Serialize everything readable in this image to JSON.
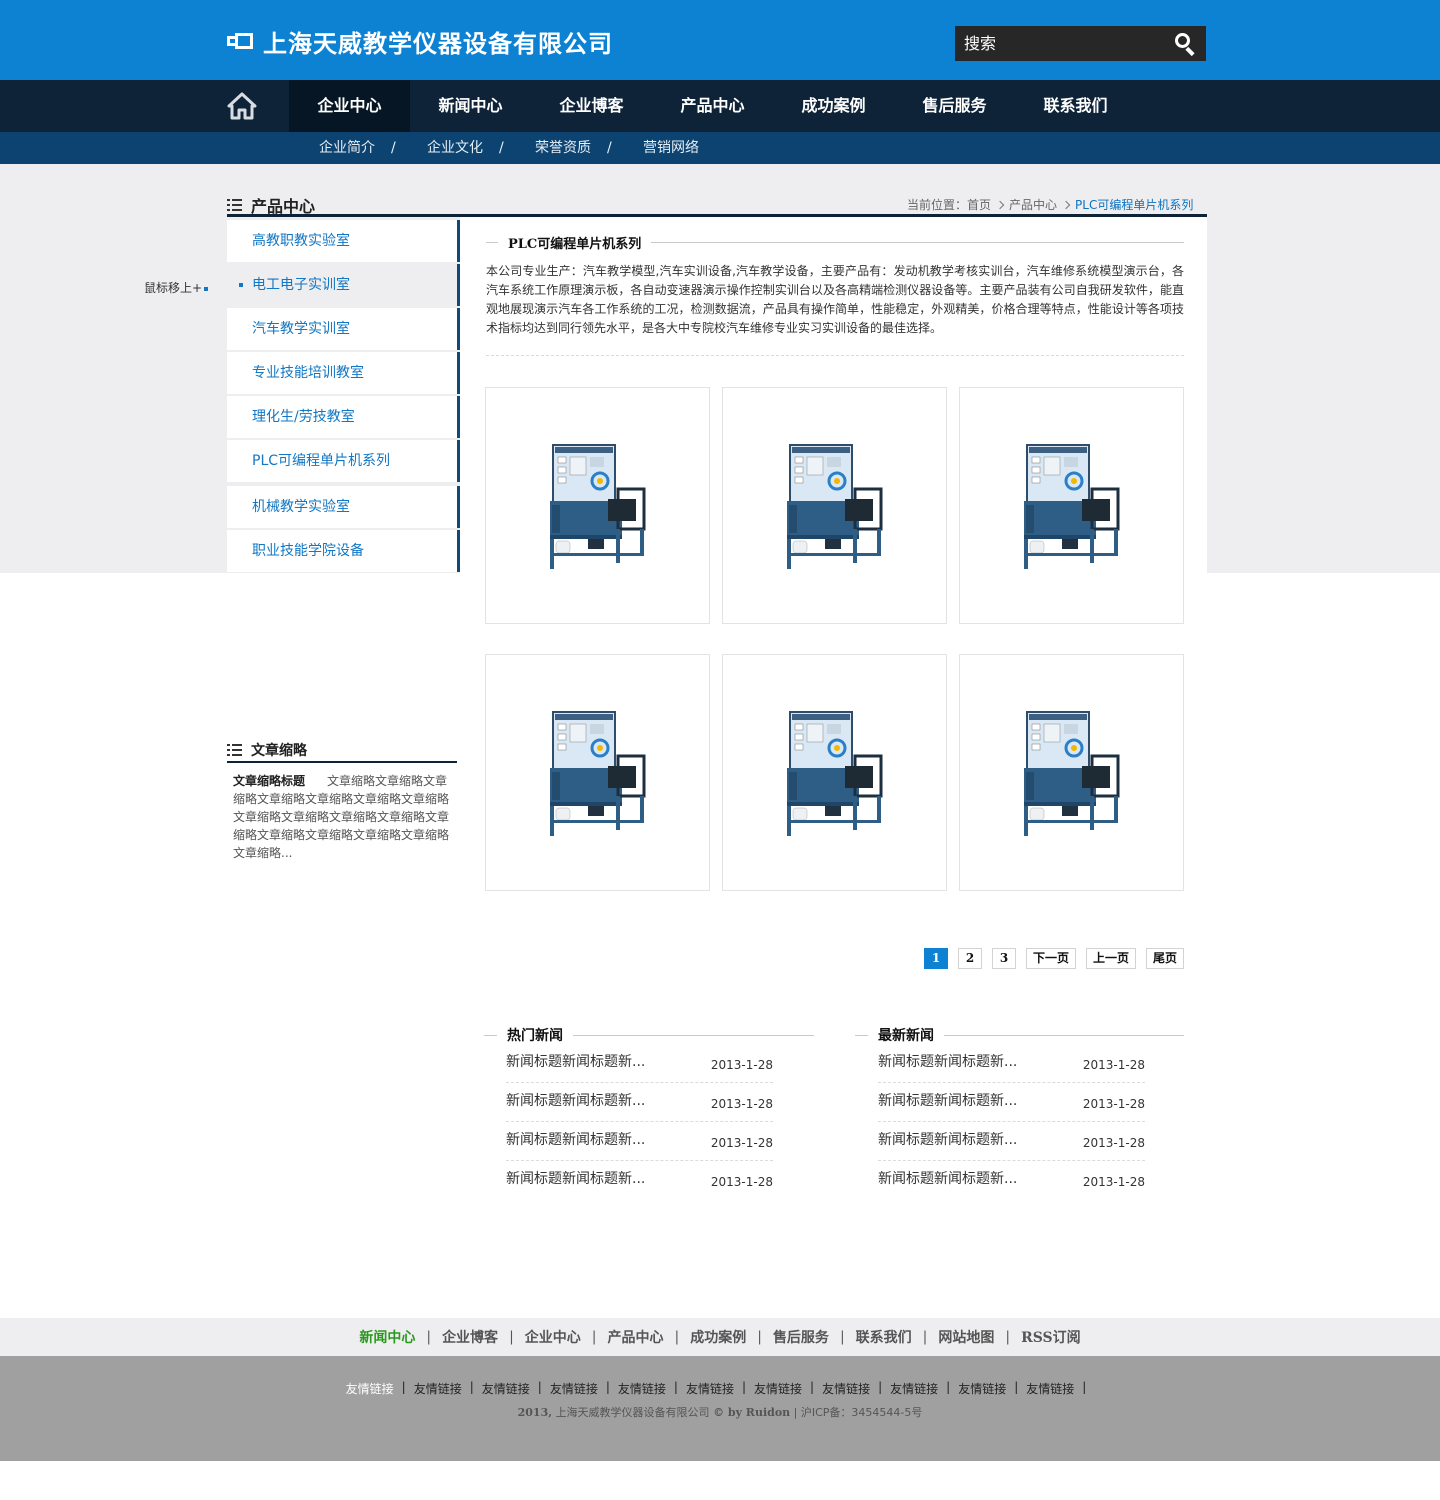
{
  "header": {
    "company_name": "上海天威教学仪器设备有限公司",
    "search_placeholder": "搜索"
  },
  "nav": {
    "items": [
      "企业中心",
      "新闻中心",
      "企业博客",
      "产品中心",
      "成功案例",
      "售后服务",
      "联系我们"
    ],
    "active": "企业中心"
  },
  "subnav": {
    "items": [
      "企业简介",
      "企业文化",
      "荣誉资质",
      "营销网络"
    ],
    "separator": "/"
  },
  "section": {
    "title": "产品中心",
    "breadcrumb_prefix": "当前位置：",
    "breadcrumb": [
      "首页",
      "产品中心",
      "PLC可编程单片机系列"
    ]
  },
  "sidebar": {
    "items": [
      "高教职教实验室",
      "电工电子实训室",
      "汽车教学实训室",
      "专业技能培训教室",
      "理化生/劳技教室",
      "PLC可编程单片机系列",
      "机械教学实验室",
      "职业技能学院设备"
    ],
    "active_index": 1,
    "hover_label": "鼠标移上+"
  },
  "main": {
    "title": "PLC可编程单片机系列",
    "description": "本公司专业生产：汽车教学模型,汽车实训设备,汽车教学设备，主要产品有：发动机教学考核实训台，汽车维修系统模型演示台，各汽车系统工作原理演示板，各自动变速器演示操作控制实训台以及各高精端检测仪器设备等。主要产品装有公司自我研发软件，能直观地展现演示汽车各工作系统的工况，检测数据流，产品具有操作简单，性能稳定，外观精美，价格合理等特点，性能设计等各项技术指标均达到同行领先水平，是各大中专院校汽车维修专业实习实训设备的最佳选择。",
    "product_count": 6
  },
  "pager": {
    "pages": [
      "1",
      "2",
      "3"
    ],
    "current": "1",
    "next": "下一页",
    "prev": "上一页",
    "last": "尾页"
  },
  "article": {
    "title": "文章缩略",
    "item_title": "文章缩略标题",
    "item_body": "文章缩略文章缩略文章缩略文章缩略文章缩略文章缩略文章缩略文章缩略文章缩略文章缩略文章缩略文章缩略文章缩略文章缩略文章缩略文章缩略文章缩略..."
  },
  "hot_news": {
    "title": "热门新闻",
    "items": [
      {
        "title": "新闻标题新闻标题新...",
        "date": "2013-1-28"
      },
      {
        "title": "新闻标题新闻标题新...",
        "date": "2013-1-28"
      },
      {
        "title": "新闻标题新闻标题新...",
        "date": "2013-1-28"
      },
      {
        "title": "新闻标题新闻标题新...",
        "date": "2013-1-28"
      }
    ]
  },
  "latest_news": {
    "title": "最新新闻",
    "items": [
      {
        "title": "新闻标题新闻标题新...",
        "date": "2013-1-28"
      },
      {
        "title": "新闻标题新闻标题新...",
        "date": "2013-1-28"
      },
      {
        "title": "新闻标题新闻标题新...",
        "date": "2013-1-28"
      },
      {
        "title": "新闻标题新闻标题新...",
        "date": "2013-1-28"
      }
    ]
  },
  "footer": {
    "links": [
      "新闻中心",
      "企业博客",
      "企业中心",
      "产品中心",
      "成功案例",
      "售后服务",
      "联系我们",
      "网站地图",
      "RSS订阅"
    ],
    "active_link": "新闻中心",
    "friend_links": [
      "友情链接",
      "友情链接",
      "友情链接",
      "友情链接",
      "友情链接",
      "友情链接",
      "友情链接",
      "友情链接",
      "友情链接",
      "友情链接",
      "友情链接"
    ],
    "copyright_year": "2013,",
    "copyright_company": "上海天威教学仪器设备有限公司",
    "copyright_by": "© by Ruidon",
    "icp": "沪ICP备：3454544-5号"
  },
  "colors": {
    "header_blue": "#0d82d3",
    "nav_dark": "#0e2338",
    "subnav_blue": "#0c4370",
    "link_blue": "#1277c4",
    "footer_green": "#2a9a1e"
  }
}
